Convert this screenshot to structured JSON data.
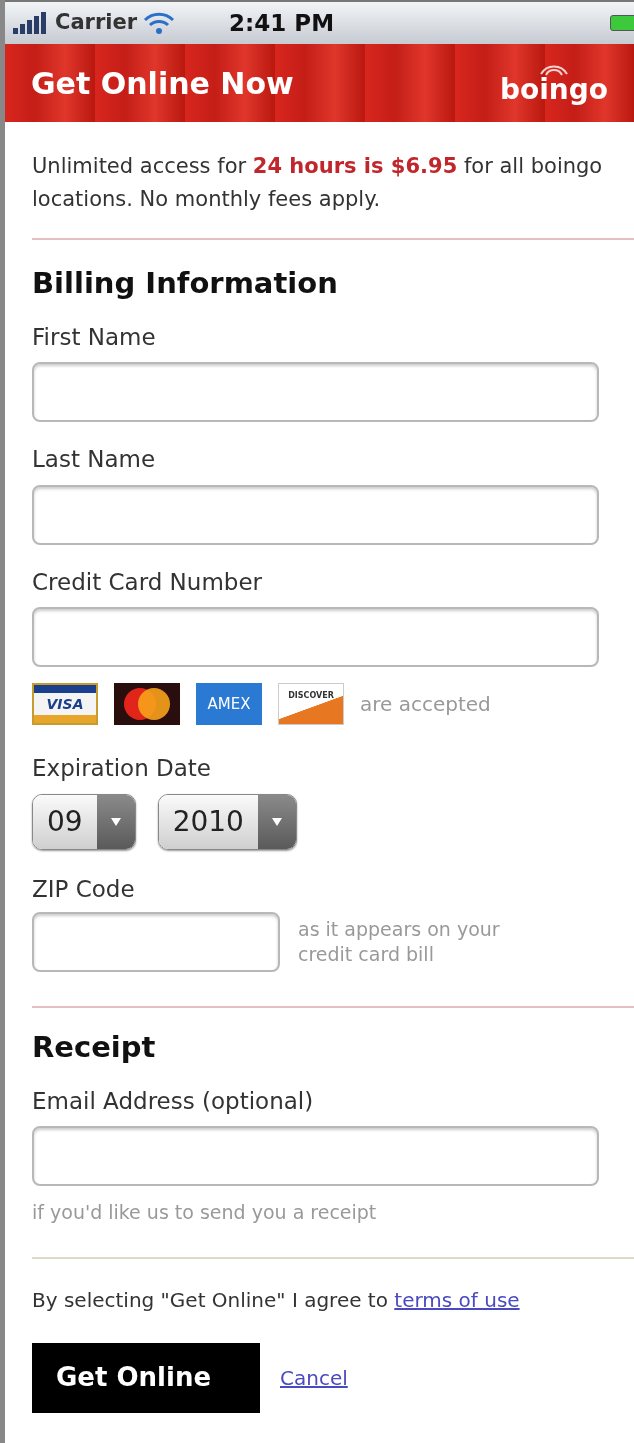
{
  "status_bar": {
    "carrier": "Carrier",
    "time": "2:41 PM"
  },
  "header": {
    "title": "Get Online Now",
    "logo": "boingo"
  },
  "intro": "Unlimited access for **24 hours is $6.95** for all boingo locations. No monthly fees apply.",
  "billing": {
    "title": "Billing Information",
    "fields": [
      {
        "kind": "text",
        "label": "First Name"
      },
      {
        "kind": "text",
        "label": "Last Name"
      },
      {
        "kind": "text",
        "label": "Credit Card Number"
      },
      {
        "kind": "cards",
        "cards": [
          {
            "kind": "visa",
            "text": "VISA"
          },
          {
            "kind": "mastercard"
          },
          {
            "kind": "amex",
            "text": "AMEX"
          },
          {
            "kind": "discover",
            "text": "DISCOVER"
          }
        ],
        "note": "are accepted"
      },
      {
        "kind": "date",
        "label": "Expiration Date",
        "selects": [
          {
            "value": "09"
          },
          {
            "value": "2010"
          }
        ]
      },
      {
        "kind": "hinted",
        "label": "ZIP Code",
        "hint": "as it appears on your credit card bill"
      }
    ]
  },
  "receipt": {
    "title": "Receipt",
    "label": "Email Address (optional)",
    "hint": "if you'd like us to send you a receipt"
  },
  "terms": {
    "text": "By selecting \"Get Online\" I agree to",
    "link": "terms of use"
  },
  "buttons": {
    "primary": "Get Online",
    "cancel": "Cancel"
  }
}
